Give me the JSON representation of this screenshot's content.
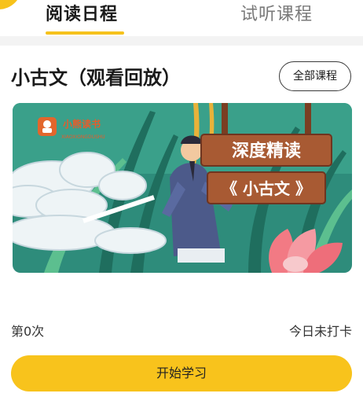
{
  "tabs": {
    "reading_schedule": "阅读日程",
    "trial_courses": "试听课程"
  },
  "course": {
    "title": "小古文（观看回放）",
    "all_courses_label": "全部课程",
    "banner": {
      "logo_text": "小熊读书",
      "logo_subtext": "XIAOXIONGDUSHU",
      "sign_line1": "深度精读",
      "sign_line2": "《 小古文 》"
    },
    "count_text": "第0次",
    "checkin_status": "今日未打卡",
    "start_label": "开始学习"
  },
  "colors": {
    "accent": "#f8c31c",
    "banner_bg": "#2f8a7a",
    "sign_wood": "#a05a34"
  }
}
